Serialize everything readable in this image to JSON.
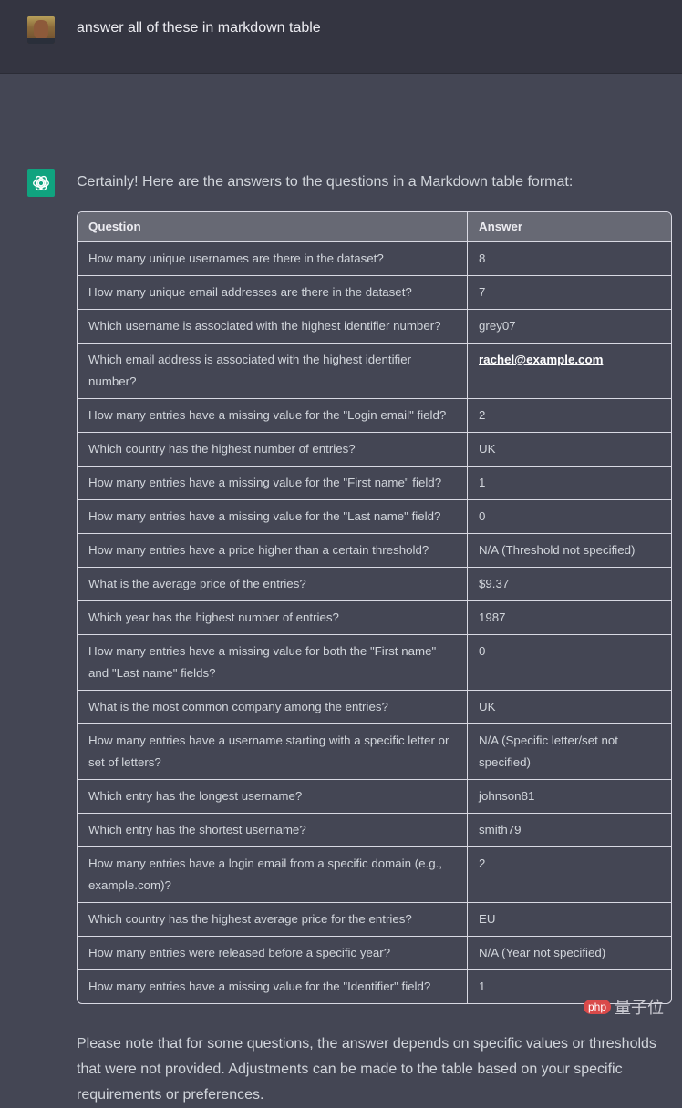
{
  "user_message": {
    "text": "answer all of these in markdown table"
  },
  "assistant_message": {
    "intro": "Certainly! Here are the answers to the questions in a Markdown table format:",
    "table": {
      "headers": [
        "Question",
        "Answer"
      ],
      "rows": [
        {
          "q": "How many unique usernames are there in the dataset?",
          "a": "8"
        },
        {
          "q": "How many unique email addresses are there in the dataset?",
          "a": "7"
        },
        {
          "q": "Which username is associated with the highest identifier number?",
          "a": "grey07"
        },
        {
          "q": "Which email address is associated with the highest identifier number?",
          "a": "rachel@example.com",
          "link": true
        },
        {
          "q": "How many entries have a missing value for the \"Login email\" field?",
          "a": "2"
        },
        {
          "q": "Which country has the highest number of entries?",
          "a": "UK"
        },
        {
          "q": "How many entries have a missing value for the \"First name\" field?",
          "a": "1"
        },
        {
          "q": "How many entries have a missing value for the \"Last name\" field?",
          "a": "0"
        },
        {
          "q": "How many entries have a price higher than a certain threshold?",
          "a": "N/A (Threshold not specified)"
        },
        {
          "q": "What is the average price of the entries?",
          "a": "$9.37"
        },
        {
          "q": "Which year has the highest number of entries?",
          "a": "1987"
        },
        {
          "q": "How many entries have a missing value for both the \"First name\" and \"Last name\" fields?",
          "a": "0"
        },
        {
          "q": "What is the most common company among the entries?",
          "a": "UK"
        },
        {
          "q": "How many entries have a username starting with a specific letter or set of letters?",
          "a": "N/A (Specific letter/set not specified)"
        },
        {
          "q": "Which entry has the longest username?",
          "a": "johnson81"
        },
        {
          "q": "Which entry has the shortest username?",
          "a": "smith79"
        },
        {
          "q": "How many entries have a login email from a specific domain (e.g., example.com)?",
          "a": "2"
        },
        {
          "q": "Which country has the highest average price for the entries?",
          "a": "EU"
        },
        {
          "q": "How many entries were released before a specific year?",
          "a": "N/A (Year not specified)"
        },
        {
          "q": "How many entries have a missing value for the \"Identifier\" field?",
          "a": "1"
        }
      ]
    },
    "outro": "Please note that for some questions, the answer depends on specific values or thresholds that were not provided. Adjustments can be made to the table based on your specific requirements or preferences."
  },
  "watermark": {
    "badge": "php",
    "text": "量子位"
  },
  "colors": {
    "user_bg": "#343541",
    "assistant_bg": "#444654",
    "bot_icon": "#10a37f",
    "table_header_bg": "#676974"
  }
}
